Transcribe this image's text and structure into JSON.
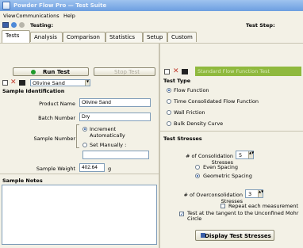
{
  "window": {
    "title": "Powder Flow Pro — Test Suite"
  },
  "menu": {
    "items": [
      "View",
      "Communications",
      "Help"
    ]
  },
  "toolbar": {
    "label": "Testing:",
    "test_step_label": "Test Step:"
  },
  "tabs": [
    "Tests",
    "Analysis",
    "Comparison",
    "Statistics",
    "Setup",
    "Custom"
  ],
  "left": {
    "run_label": "Run Test",
    "stop_label": "Stop Test",
    "sample_value": "Olivine Sand",
    "section_title": "Sample Identification",
    "product_name_label": "Product Name",
    "product_name_value": "Olivine Sand",
    "batch_number_label": "Batch Number",
    "batch_number_value": "Dry",
    "sample_number_label": "Sample Number",
    "increment_label": "Increment Automatically",
    "set_manually_label": "Set Manually :",
    "sample_weight_label": "Sample Weight",
    "sample_weight_value": "402.64",
    "weight_unit": "g",
    "notes_title": "Sample Notes"
  },
  "right": {
    "test_type_value": "Standard Flow Function Test",
    "test_type_title": "Test Type",
    "test_types": [
      "Flow Function",
      "Time Consolidated Flow Function",
      "Wall Friction",
      "Bulk Density Curve"
    ],
    "test_stresses_title": "Test Stresses",
    "consolidation_label": "# of Consolidation Stresses",
    "consolidation_value": "5",
    "even_spacing_label": "Even Spacing",
    "geometric_spacing_label": "Geometric Spacing",
    "overconsolidation_label": "# of Overconsolidation Stresses",
    "overconsolidation_value": "3",
    "repeat_label": "Repeat each measurement",
    "tangent_label_line1": "Test at the tangent to the Unconfined Mohr",
    "tangent_label_line2": "Circle",
    "display_button_label": "Display Test Stresses"
  },
  "colors": {
    "title_bar": "#6c9ee0",
    "run_green": "#1e9a2b",
    "accent_blue": "#1a4f9c"
  }
}
